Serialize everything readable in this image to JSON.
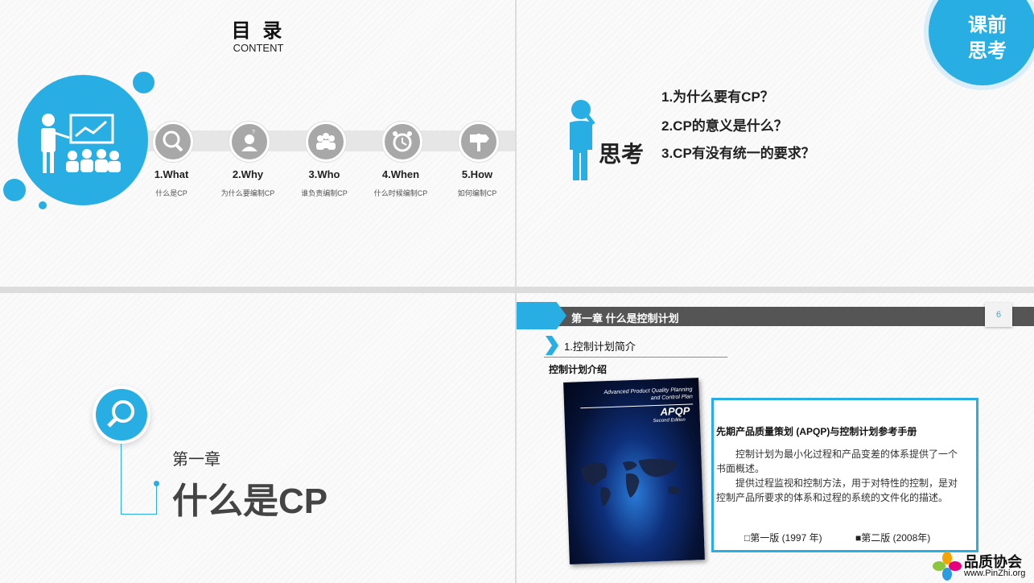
{
  "slide1": {
    "title": "目 录",
    "subtitle": "CONTENT",
    "items": [
      {
        "label": "1.What",
        "sub": "什么是CP"
      },
      {
        "label": "2.Why",
        "sub": "为什么要编制CP"
      },
      {
        "label": "3.Who",
        "sub": "谁负责编制CP"
      },
      {
        "label": "4.When",
        "sub": "什么时候编制CP"
      },
      {
        "label": "5.How",
        "sub": "如何编制CP"
      }
    ]
  },
  "slide2": {
    "badge_line1": "课前",
    "badge_line2": "思考",
    "think_label": "思考",
    "questions": [
      "1.为什么要有CP？",
      "2.CP的意义是什么？",
      "3.CP有没有统一的要求？"
    ]
  },
  "slide3": {
    "chapter": "第一章",
    "title": "什么是CP"
  },
  "slide4": {
    "header": "第一章 什么是控制计划",
    "page_number": "6",
    "section": "1.控制计划简介",
    "subsection": "控制计划介绍",
    "book": {
      "line1": "Advanced Product Quality Planning",
      "line2": "and Control Plan",
      "title": "APQP",
      "edition": "Second Edition"
    },
    "panel_title": "先期产品质量策划 (APQP)与控制计划参考手册",
    "panel_para1": "控制计划为最小化过程和产品变差的体系提供了一个书面概述。",
    "panel_para2": "提供过程监视和控制方法，用于对特性的控制，是对控制产品所要求的体系和过程的系统的文件化的描述。",
    "edition1": "□第一版 (1997 年)",
    "edition2": "■第二版 (2008年)"
  },
  "watermark": {
    "name": "品质协会",
    "url": "www.PinZhi.org"
  },
  "colors": {
    "accent": "#29aee3",
    "header_gray": "#555555"
  }
}
